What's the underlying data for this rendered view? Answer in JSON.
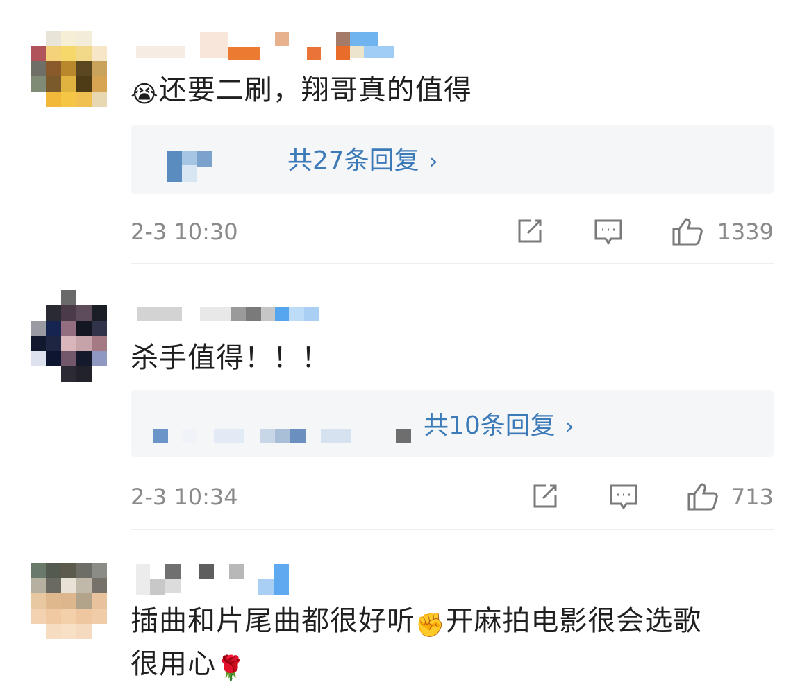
{
  "comments": [
    {
      "text": "还要二刷，翔哥真的值得",
      "leading_emoji": "😭",
      "reply_link": "共27条回复",
      "time": "2-3 10:30",
      "likes": "1339"
    },
    {
      "text": "杀手值得！！！",
      "reply_link": "共10条回复",
      "time": "2-3 10:34",
      "likes": "713"
    },
    {
      "text_line1_a": "插曲和片尾曲都很好听",
      "emoji_mid": "✊",
      "text_line1_b": "开麻拍电影很会选歌",
      "text_line2": "很用心",
      "emoji_end": "🌹"
    }
  ],
  "icons": {
    "forward": "share-out-icon",
    "comment": "comment-icon",
    "like": "thumbs-up-icon",
    "chevron": "chevron-right-icon"
  },
  "colors": {
    "link": "#3d7ab8",
    "meta": "#8a8a8a",
    "reply_bg": "#f5f6f8"
  }
}
